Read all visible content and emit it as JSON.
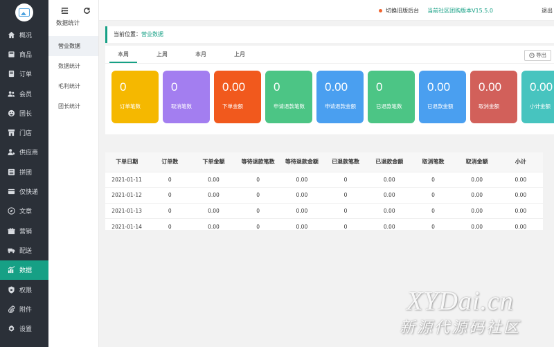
{
  "sidebar": {
    "items": [
      {
        "label": "概况",
        "icon": "home-icon"
      },
      {
        "label": "商品",
        "icon": "goods-icon"
      },
      {
        "label": "订单",
        "icon": "order-icon"
      },
      {
        "label": "会员",
        "icon": "member-icon"
      },
      {
        "label": "团长",
        "icon": "leader-icon"
      },
      {
        "label": "门店",
        "icon": "store-icon"
      },
      {
        "label": "供应商",
        "icon": "supplier-icon"
      },
      {
        "label": "拼团",
        "icon": "group-buy-icon"
      },
      {
        "label": "仅快递",
        "icon": "express-icon"
      },
      {
        "label": "文章",
        "icon": "article-icon"
      },
      {
        "label": "营销",
        "icon": "marketing-icon"
      },
      {
        "label": "配送",
        "icon": "delivery-icon"
      },
      {
        "label": "数据",
        "icon": "chart-icon",
        "active": true
      },
      {
        "label": "权限",
        "icon": "permission-icon"
      },
      {
        "label": "附件",
        "icon": "attachment-icon"
      },
      {
        "label": "设置",
        "icon": "settings-icon"
      }
    ]
  },
  "submenu": {
    "title": "数据统计",
    "items": [
      "营业数据",
      "数据统计",
      "毛利统计",
      "团长统计"
    ]
  },
  "topbar": {
    "switch_label": "切换旧版后台",
    "version_label": "当前社区团购版本V15.5.0",
    "logout_label": "退出"
  },
  "breadcrumb": {
    "label": "当前位置：",
    "current": "营业数据"
  },
  "tabs": [
    "本周",
    "上周",
    "本月",
    "上月"
  ],
  "export_label": "导出",
  "cards": [
    {
      "value": "0",
      "label": "订单笔数",
      "color": "#f5b800"
    },
    {
      "value": "0",
      "label": "取消笔数",
      "color": "#a37ef0"
    },
    {
      "value": "0.00",
      "label": "下单金额",
      "color": "#f1591d"
    },
    {
      "value": "0",
      "label": "申请退款笔数",
      "color": "#4cc585"
    },
    {
      "value": "0.00",
      "label": "申请退款金额",
      "color": "#4a9ff0"
    },
    {
      "value": "0",
      "label": "已退款笔数",
      "color": "#4cc585"
    },
    {
      "value": "0.00",
      "label": "已退款金额",
      "color": "#4a9ff0"
    },
    {
      "value": "0.00",
      "label": "取消金额",
      "color": "#d2605a"
    },
    {
      "value": "0.00",
      "label": "小计金额",
      "color": "#47c4bf"
    }
  ],
  "table": {
    "headers": [
      "下单日期",
      "订单数",
      "下单金额",
      "等待退款笔数",
      "等待退款金额",
      "已退款笔数",
      "已退款金额",
      "取消笔数",
      "取消金额",
      "小计"
    ],
    "rows": [
      [
        "2021-01-11",
        "0",
        "0.00",
        "0",
        "0.00",
        "0",
        "0.00",
        "0",
        "0.00",
        "0.00"
      ],
      [
        "2021-01-12",
        "0",
        "0.00",
        "0",
        "0.00",
        "0",
        "0.00",
        "0",
        "0.00",
        "0.00"
      ],
      [
        "2021-01-13",
        "0",
        "0.00",
        "0",
        "0.00",
        "0",
        "0.00",
        "0",
        "0.00",
        "0.00"
      ],
      [
        "2021-01-14",
        "0",
        "0.00",
        "0",
        "0.00",
        "0",
        "0.00",
        "0",
        "0.00",
        "0.00"
      ]
    ]
  },
  "watermark": {
    "big": "XYDai.cn",
    "small": "新源代源码社区"
  }
}
